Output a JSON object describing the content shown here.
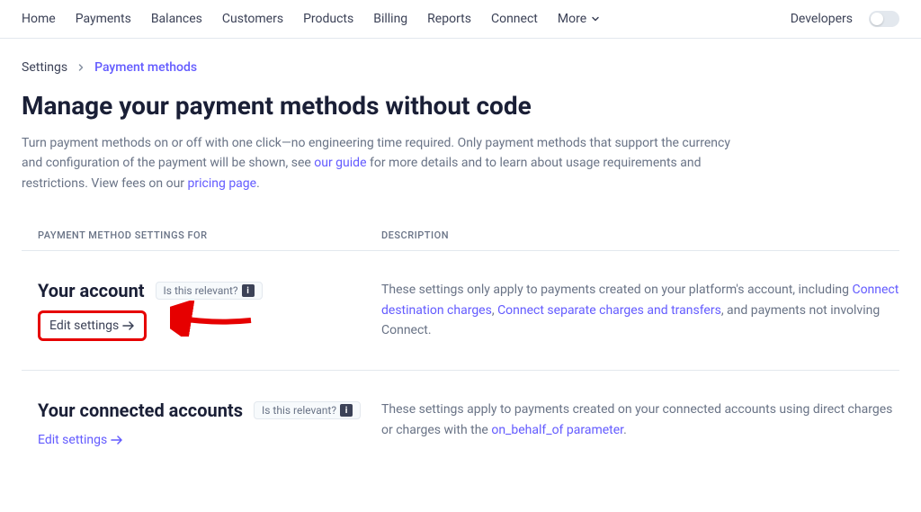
{
  "nav": {
    "items": [
      "Home",
      "Payments",
      "Balances",
      "Customers",
      "Products",
      "Billing",
      "Reports",
      "Connect"
    ],
    "more": "More",
    "developers": "Developers"
  },
  "breadcrumb": {
    "root": "Settings",
    "current": "Payment methods"
  },
  "page": {
    "title": "Manage your payment methods without code",
    "intro_1": "Turn payment methods on or off with one click—no engineering time required. Only payment methods that support the currency and configuration of the payment will be shown, see ",
    "intro_link1": "our guide",
    "intro_2": " for more details and to learn about usage requirements and restrictions. View fees on our ",
    "intro_link2": "pricing page",
    "intro_3": "."
  },
  "table": {
    "header_left": "PAYMENT METHOD SETTINGS FOR",
    "header_right": "DESCRIPTION"
  },
  "relevance_label": "Is this relevant?",
  "sections": [
    {
      "title": "Your account",
      "edit": "Edit settings",
      "desc_1": "These settings only apply to payments created on your platform's account, including ",
      "link_1": "Connect destination charges",
      "sep_1": ", ",
      "link_2": "Connect separate charges and transfers",
      "desc_2": ", and payments not involving Connect."
    },
    {
      "title": "Your connected accounts",
      "edit": "Edit settings",
      "desc_1": "These settings apply to payments created on your connected accounts using direct charges or charges with the ",
      "link_1": "on_behalf_of parameter",
      "desc_2": "."
    }
  ]
}
